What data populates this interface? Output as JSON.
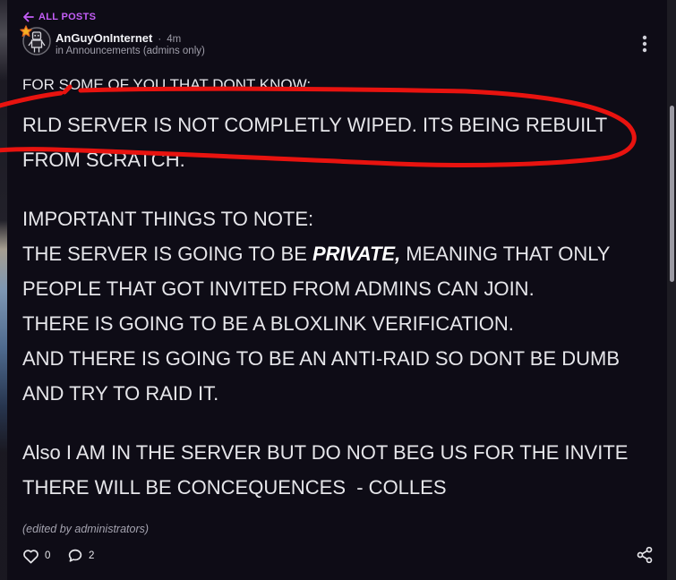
{
  "nav": {
    "back_label": "ALL POSTS"
  },
  "post": {
    "author": "AnGuyOnInternet",
    "separator": "·",
    "time_ago": "4m",
    "channel": "in Announcements (admins only)",
    "intro": "FOR SOME OF YOU THAT DONT KNOW:",
    "paragraphs": [
      {
        "lines": [
          "RLD SERVER IS NOT COMPLETLY WIPED. ITS BEING REBUILT",
          "FROM SCRATCH."
        ]
      },
      {
        "heading": "IMPORTANT THINGS TO NOTE:",
        "private_line": {
          "before": "THE SERVER IS GOING TO BE ",
          "emphasis": "PRIVATE,",
          "after": " MEANING THAT ONLY"
        },
        "lines": [
          "PEOPLE THAT GOT INVITED FROM ADMINS CAN JOIN.",
          "THERE IS GOING TO BE A BLOXLINK VERIFICATION.",
          "AND THERE IS GOING TO BE AN ANTI-RAID SO DONT BE DUMB",
          "AND TRY TO RAID IT."
        ]
      },
      {
        "lines": [
          "Also I AM IN THE SERVER BUT DO NOT BEG US FOR THE INVITE",
          "THERE WILL BE CONCEQUENCES  - COLLES"
        ]
      }
    ],
    "edited_note": "(edited by administrators)",
    "like_count": "0",
    "comment_count": "2"
  },
  "icons": {
    "back": "arrow-left-icon",
    "avatar": "avatar-icon",
    "badge": "star-badge-icon",
    "menu": "kebab-menu-icon",
    "like": "heart-icon",
    "comment": "comment-icon",
    "share": "share-icon"
  },
  "colors": {
    "background": "#0e0c16",
    "text": "#e6e6ea",
    "muted": "#9e9daa",
    "accent": "#c45ef7",
    "annotation": "#e8130f",
    "badge": "#f5b224"
  }
}
